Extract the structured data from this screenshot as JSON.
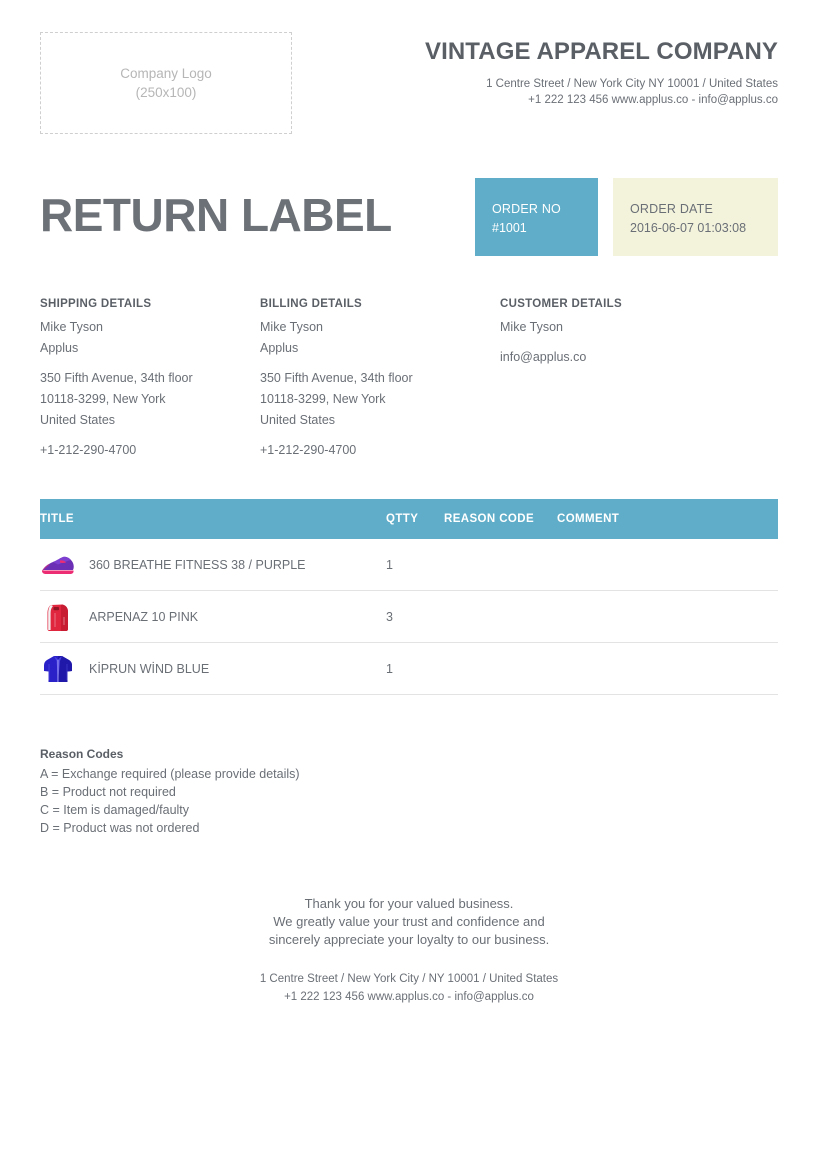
{
  "header": {
    "logo_placeholder_name": "Company Logo",
    "logo_placeholder_size": "(250x100)",
    "company_name": "VINTAGE APPAREL COMPANY",
    "address_line1": "1 Centre Street / New York City NY 10001 / United States",
    "address_line2": "+1 222 123 456 www.applus.co - info@applus.co"
  },
  "document": {
    "title": "RETURN LABEL",
    "order_no_label": "ORDER NO",
    "order_no_value": "#1001",
    "order_date_label": "ORDER DATE",
    "order_date_value": "2016-06-07 01:03:08",
    "accent_color": "#5fadc8",
    "date_box_color": "#f3f3dc"
  },
  "shipping": {
    "heading": "SHIPPING DETAILS",
    "name": "Mike Tyson",
    "company": "Applus",
    "street": "350 Fifth Avenue, 34th floor",
    "city": "10118-3299, New York",
    "country": "United States",
    "phone": "+1-212-290-4700"
  },
  "billing": {
    "heading": "BILLING DETAILS",
    "name": "Mike Tyson",
    "company": "Applus",
    "street": "350 Fifth Avenue, 34th floor",
    "city": "10118-3299, New York",
    "country": "United States",
    "phone": "+1-212-290-4700"
  },
  "customer": {
    "heading": "CUSTOMER DETAILS",
    "name": "Mike Tyson",
    "email": "info@applus.co"
  },
  "items_table": {
    "columns": [
      "TITLE",
      "QTTY",
      "REASON CODE",
      "COMMENT"
    ],
    "rows": [
      {
        "thumb": "sneaker-purple-thumb",
        "title": "360 BREATHE FITNESS 38 / PURPLE",
        "qtty": "1",
        "reason_code": "",
        "comment": ""
      },
      {
        "thumb": "backpack-pink-thumb",
        "title": "ARPENAZ 10 PINK",
        "qtty": "3",
        "reason_code": "",
        "comment": ""
      },
      {
        "thumb": "jacket-blue-thumb",
        "title": "KİPRUN WİND BLUE",
        "qtty": "1",
        "reason_code": "",
        "comment": ""
      }
    ]
  },
  "reason_codes": {
    "title": "Reason Codes",
    "items": [
      "A = Exchange required (please provide details)",
      "B = Product not required",
      "C = Item is damaged/faulty",
      "D = Product was not ordered"
    ]
  },
  "footer": {
    "thanks_line1": "Thank you for your valued business.",
    "thanks_line2": "We greatly value your trust and confidence and",
    "thanks_line3": "sincerely appreciate your loyalty to our business.",
    "contact_line1": "1 Centre Street / New York City / NY 10001 / United States",
    "contact_line2": "+1 222 123 456   www.applus.co - info@applus.co"
  }
}
